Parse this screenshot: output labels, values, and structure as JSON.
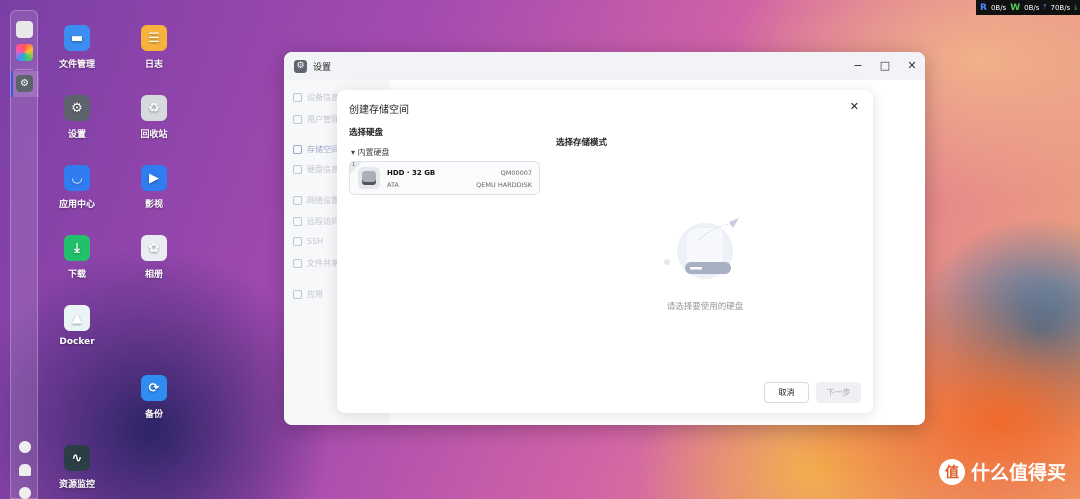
{
  "status_bar": {
    "read_label": "R",
    "read": "0B/s",
    "write_label": "W",
    "write": "0B/s",
    "upload": "70B/s"
  },
  "desktop_icons": [
    {
      "label": "文件管理",
      "icon": "folder-icon",
      "color": "#3b8df0"
    },
    {
      "label": "日志",
      "icon": "log-icon",
      "color": "#f6b23c"
    },
    {
      "label": "设置",
      "icon": "gear-icon",
      "color": "#5d636d"
    },
    {
      "label": "回收站",
      "icon": "recycle-icon",
      "color": "#d6dadf"
    },
    {
      "label": "应用中心",
      "icon": "store-icon",
      "color": "#2f7df0"
    },
    {
      "label": "影视",
      "icon": "video-icon",
      "color": "#2f7df0"
    },
    {
      "label": "下载",
      "icon": "download-icon",
      "color": "#22c06a"
    },
    {
      "label": "相册",
      "icon": "photos-icon",
      "color": "#e9ecf2"
    },
    {
      "label": "Docker",
      "icon": "docker-icon",
      "color": "#e9f4f6"
    },
    {
      "label": "备份",
      "icon": "backup-icon",
      "color": "#2f8cf0"
    },
    {
      "label": "资源监控",
      "icon": "monitor-icon",
      "color": "#2c3e45"
    }
  ],
  "settings_window": {
    "title": "设置",
    "sidebar": [
      "设备信息",
      "用户管理",
      "存储空间",
      "硬盘信息",
      "网络设置",
      "远程访问",
      "SSH",
      "文件共享",
      "应用"
    ],
    "active_index": 2
  },
  "dialog": {
    "title": "创建存储空间",
    "select_disk_heading": "选择硬盘",
    "group_label": "内置硬盘",
    "disk": {
      "index": "1",
      "name": "HDD · 32 GB",
      "type": "ATA",
      "serial": "QM00007",
      "model": "QEMU HARDDISK"
    },
    "mode_heading": "选择存储模式",
    "empty_text": "请选择要使用的硬盘",
    "cancel": "取消",
    "next": "下一步"
  },
  "watermark": {
    "logo": "值",
    "text": "什么值得买"
  }
}
